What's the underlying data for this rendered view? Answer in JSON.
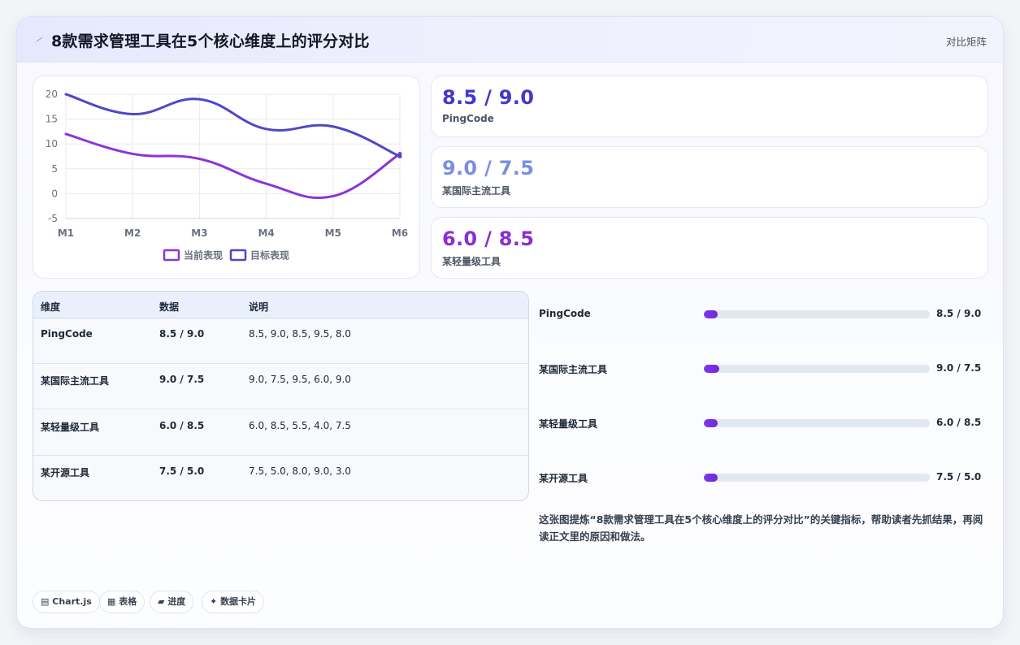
{
  "header": {
    "title": "8款需求管理工具在5个核心维度上的评分对比",
    "tag": "对比矩阵",
    "icon": "sparkle-icon"
  },
  "chart_data": {
    "type": "line",
    "x": [
      "M1",
      "M2",
      "M3",
      "M4",
      "M5",
      "M6"
    ],
    "yticks": [
      20,
      15,
      10,
      5,
      0,
      -5
    ],
    "ylim": [
      -5,
      20
    ],
    "grid": true,
    "legend_position": "bottom",
    "series": [
      {
        "name": "当前表现",
        "color": "#8b35d6",
        "values": [
          12,
          8,
          7,
          2,
          -0.5,
          8
        ]
      },
      {
        "name": "目标表现",
        "color": "#4f46c9",
        "values": [
          20,
          16,
          19,
          13,
          13.5,
          7.5
        ]
      }
    ]
  },
  "stats": [
    {
      "value": "8.5 / 9.0",
      "label": "PingCode",
      "color": "#4338ca"
    },
    {
      "value": "9.0 / 7.5",
      "label": "某国际主流工具",
      "color": "#7b8fe0"
    },
    {
      "value": "6.0 / 8.5",
      "label": "某轻量级工具",
      "color": "#8b2fd0"
    }
  ],
  "table": {
    "headers": [
      "维度",
      "数据",
      "说明"
    ],
    "rows": [
      [
        "PingCode",
        "8.5 / 9.0",
        "8.5, 9.0, 8.5, 9.5, 8.0"
      ],
      [
        "某国际主流工具",
        "9.0 / 7.5",
        "9.0, 7.5, 9.5, 6.0, 9.0"
      ],
      [
        "某轻量级工具",
        "6.0 / 8.5",
        "6.0, 8.5, 5.5, 4.0, 7.5"
      ],
      [
        "某开源工具",
        "7.5 / 5.0",
        "7.5, 5.0, 8.0, 9.0, 3.0"
      ]
    ]
  },
  "progress": [
    {
      "label": "PingCode",
      "value": "8.5 / 9.0",
      "fill": 0.06
    },
    {
      "label": "某国际主流工具",
      "value": "9.0 / 7.5",
      "fill": 0.07
    },
    {
      "label": "某轻量级工具",
      "value": "6.0 / 8.5",
      "fill": 0.06
    },
    {
      "label": "某开源工具",
      "value": "7.5 / 5.0",
      "fill": 0.06
    }
  ],
  "summary": "这张图提炼“8款需求管理工具在5个核心维度上的评分对比”的关键指标，帮助读者先抓结果，再阅读正文里的原因和做法。",
  "chips": [
    {
      "icon": "chart-icon",
      "glyph": "▤",
      "label": "Chart.js"
    },
    {
      "icon": "table-icon",
      "glyph": "▦",
      "label": "表格"
    },
    {
      "icon": "progress-icon",
      "glyph": "▰",
      "label": "进度"
    },
    {
      "icon": "sparkle-icon",
      "glyph": "✦",
      "label": "数据卡片"
    }
  ]
}
